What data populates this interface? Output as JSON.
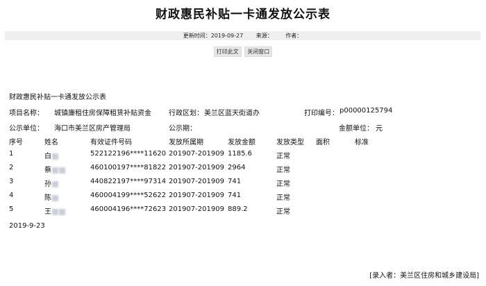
{
  "title": "财政惠民补贴一卡通发放公示表",
  "meta": {
    "update": "更新时间：2019-09-27",
    "source": "来源：",
    "author": "作者："
  },
  "buttons": {
    "print": "打印此文",
    "close": "关闭窗口"
  },
  "doc": {
    "subtitle": "财政惠民补贴一卡通发放公示表",
    "project_label": "项目名称：",
    "project": "城镇廉租住房保障租赁补贴资金",
    "region_label": "行政区划：",
    "region": "美兰区蓝天街道办",
    "print_no_label": "打印编号：",
    "print_no": "p00000125794",
    "unit_label": "公示单位：",
    "unit": "海口市美兰区房产管理局",
    "period_label": "公示期：",
    "amount_unit_label": "金额单位：",
    "amount_unit": "元",
    "headers": [
      "序号",
      "姓名",
      "有效证件号码",
      "发放所属期",
      "发放金额",
      "发放类型",
      "面积",
      "标准"
    ],
    "rows": [
      [
        "1",
        "白",
        "522122196****11620",
        "201907-201909",
        "1185.6",
        "正常",
        "",
        ""
      ],
      [
        "2",
        "蔡",
        "460100197****81822",
        "201907-201909",
        "2964",
        "正常",
        "",
        ""
      ],
      [
        "3",
        "孙",
        "440822197****97314",
        "201907-201909",
        "741",
        "正常",
        "",
        ""
      ],
      [
        "4",
        "陈",
        "460004199****52622",
        "201907-201909",
        "741",
        "正常",
        "",
        ""
      ],
      [
        "5",
        "王",
        "460004196****72623",
        "201907-201909",
        "889.2",
        "正常",
        "",
        ""
      ]
    ],
    "date": "2019-9-23",
    "footer": "[录入者：美兰区住房和城乡建设局]"
  }
}
